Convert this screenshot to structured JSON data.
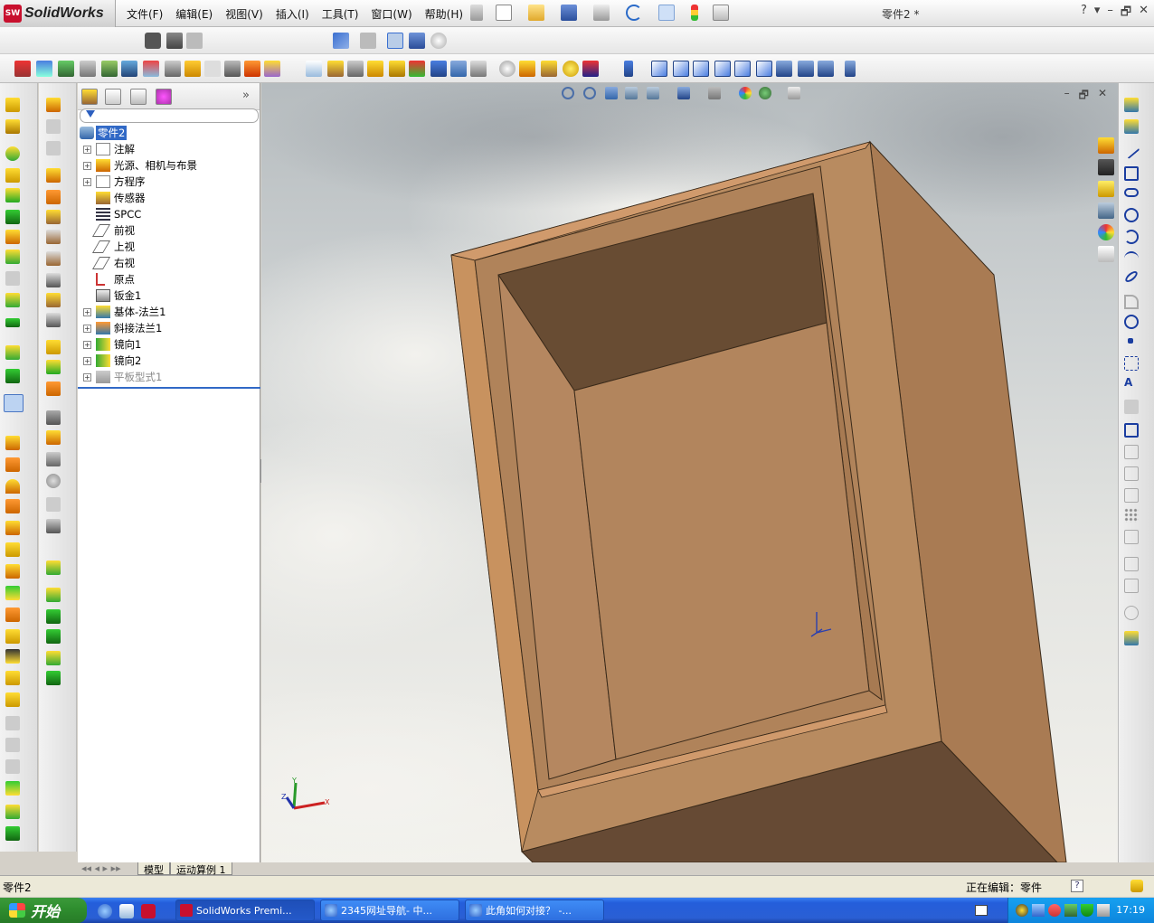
{
  "app": {
    "logo_text": "SolidWorks",
    "title": "零件2 *",
    "win_controls": [
      "?",
      "▾",
      "–",
      "🗗",
      "✕"
    ]
  },
  "menu": [
    "文件(F)",
    "编辑(E)",
    "视图(V)",
    "插入(I)",
    "工具(T)",
    "窗口(W)",
    "帮助(H)"
  ],
  "feature_tree": {
    "root": "零件2",
    "items": [
      {
        "label": "注解",
        "expandable": true,
        "icon": "annotation-icon"
      },
      {
        "label": "光源、相机与布景",
        "expandable": true,
        "icon": "lights-icon"
      },
      {
        "label": "方程序",
        "expandable": true,
        "icon": "equation-icon"
      },
      {
        "label": "传感器",
        "expandable": false,
        "icon": "sensor-icon"
      },
      {
        "label": "SPCC",
        "expandable": false,
        "icon": "material-icon"
      },
      {
        "label": "前视",
        "expandable": false,
        "icon": "plane-icon"
      },
      {
        "label": "上视",
        "expandable": false,
        "icon": "plane-icon"
      },
      {
        "label": "右视",
        "expandable": false,
        "icon": "plane-icon"
      },
      {
        "label": "原点",
        "expandable": false,
        "icon": "origin-icon"
      },
      {
        "label": "钣金1",
        "expandable": false,
        "icon": "sheetmetal-icon"
      },
      {
        "label": "基体-法兰1",
        "expandable": true,
        "icon": "base-flange-icon"
      },
      {
        "label": "斜接法兰1",
        "expandable": true,
        "icon": "miter-flange-icon"
      },
      {
        "label": "镜向1",
        "expandable": true,
        "icon": "mirror-icon"
      },
      {
        "label": "镜向2",
        "expandable": true,
        "icon": "mirror-icon"
      },
      {
        "label": "平板型式1",
        "expandable": true,
        "icon": "flat-pattern-icon",
        "suppressed": true
      }
    ]
  },
  "bottom_tabs": [
    "模型",
    "运动算例 1"
  ],
  "status": {
    "left": "零件2",
    "right": "正在编辑：零件"
  },
  "taskbar": {
    "start": "开始",
    "tasks": [
      "SolidWorks Premi...",
      "2345网址导航- 中...",
      "此角如何对接？ -..."
    ],
    "clock": "17:19"
  },
  "colors": {
    "part_face": "#b07f56",
    "part_inner": "#6a4a30",
    "selection": "#3169c6",
    "taskbar": "#245edb"
  }
}
